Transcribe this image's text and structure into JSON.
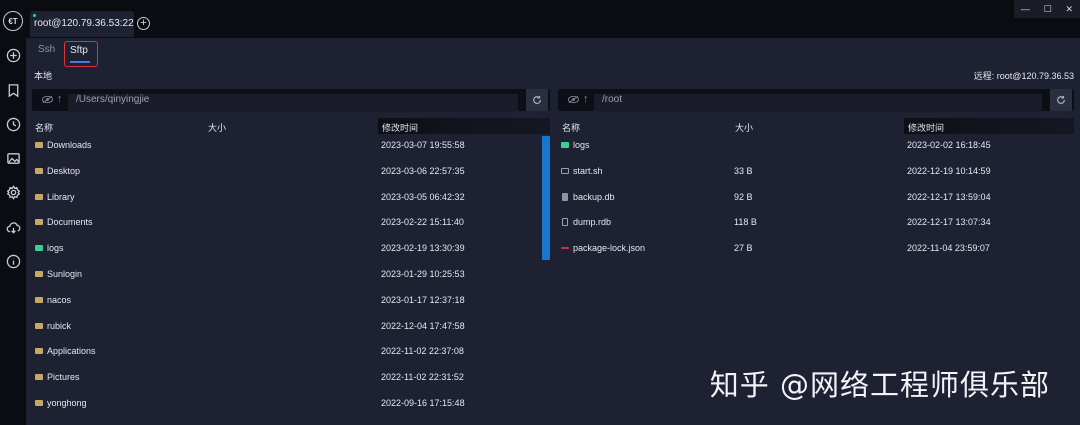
{
  "logo": "€T",
  "session_tab": {
    "label": "root@120.79.36.53:22"
  },
  "window_controls": {
    "minimize": "—",
    "maximize": "☐",
    "close": "✕"
  },
  "subtabs": [
    {
      "label": "Ssh"
    },
    {
      "label": "Sftp"
    }
  ],
  "local": {
    "title": "本地",
    "path": "/Users/qinyingjie",
    "columns": [
      "名称",
      "大小",
      "修改时间"
    ],
    "rows": [
      {
        "name": "Downloads",
        "size": "",
        "modified": "2023-03-07 19:55:58",
        "type": "folder"
      },
      {
        "name": "Desktop",
        "size": "",
        "modified": "2023-03-06 22:57:35",
        "type": "folder"
      },
      {
        "name": "Library",
        "size": "",
        "modified": "2023-03-05 06:42:32",
        "type": "folder"
      },
      {
        "name": "Documents",
        "size": "",
        "modified": "2023-02-22 15:11:40",
        "type": "folder"
      },
      {
        "name": "logs",
        "size": "",
        "modified": "2023-02-19 13:30:39",
        "type": "folder-green"
      },
      {
        "name": "Sunlogin",
        "size": "",
        "modified": "2023-01-29 10:25:53",
        "type": "folder"
      },
      {
        "name": "nacos",
        "size": "",
        "modified": "2023-01-17 12:37:18",
        "type": "folder"
      },
      {
        "name": "rubick",
        "size": "",
        "modified": "2022-12-04 17:47:58",
        "type": "folder"
      },
      {
        "name": "Applications",
        "size": "",
        "modified": "2022-11-02 22:37:08",
        "type": "folder"
      },
      {
        "name": "Pictures",
        "size": "",
        "modified": "2022-11-02 22:31:52",
        "type": "folder"
      },
      {
        "name": "yonghong",
        "size": "",
        "modified": "2022-09-16 17:15:48",
        "type": "folder"
      }
    ]
  },
  "remote": {
    "title": "远程: root@120.79.36.53",
    "path": "/root",
    "columns": [
      "名称",
      "大小",
      "修改时间"
    ],
    "rows": [
      {
        "name": "logs",
        "size": "",
        "modified": "2023-02-02 16:18:45",
        "type": "folder-green"
      },
      {
        "name": "start.sh",
        "size": "33 B",
        "modified": "2022-12-19 10:14:59",
        "type": "script"
      },
      {
        "name": "backup.db",
        "size": "92 B",
        "modified": "2022-12-17 13:59:04",
        "type": "db"
      },
      {
        "name": "dump.rdb",
        "size": "118 B",
        "modified": "2022-12-17 13:07:34",
        "type": "file"
      },
      {
        "name": "package-lock.json",
        "size": "27 B",
        "modified": "2022-11-04 23:59:07",
        "type": "json"
      }
    ]
  },
  "watermark": "知乎 @网络工程师俱乐部",
  "colors": {
    "accent": "#1677d2",
    "highlight": "#e0303a",
    "folder": "#c8a86a",
    "folder_green": "#3ecf8e"
  }
}
